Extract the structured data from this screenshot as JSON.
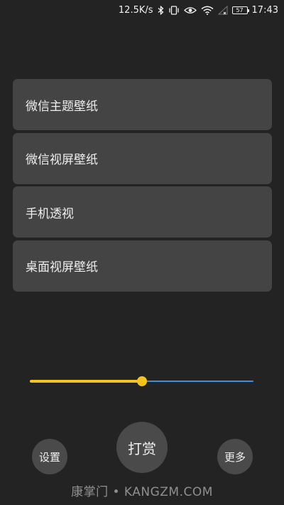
{
  "status_bar": {
    "network_speed": "12.5K/s",
    "battery_level": "57",
    "time": "17:43",
    "icons": [
      "bluetooth-icon",
      "vibrate-icon",
      "eye-icon",
      "wifi-icon",
      "no-signal-icon",
      "battery-icon"
    ]
  },
  "menu": {
    "items": [
      {
        "label": "微信主题壁纸"
      },
      {
        "label": "微信视屏壁纸"
      },
      {
        "label": "手机透视"
      },
      {
        "label": "桌面视屏壁纸"
      }
    ]
  },
  "slider": {
    "value": 0.5,
    "fill_color": "#f6c21d",
    "track_color": "#3d8fd9"
  },
  "buttons": {
    "settings_label": "设置",
    "reward_label": "打赏",
    "more_label": "更多"
  },
  "watermark": {
    "text": "康掌门 • KANGZM.COM"
  },
  "colors": {
    "background": "#232323",
    "card": "#444444",
    "button": "#4a4a4a"
  }
}
